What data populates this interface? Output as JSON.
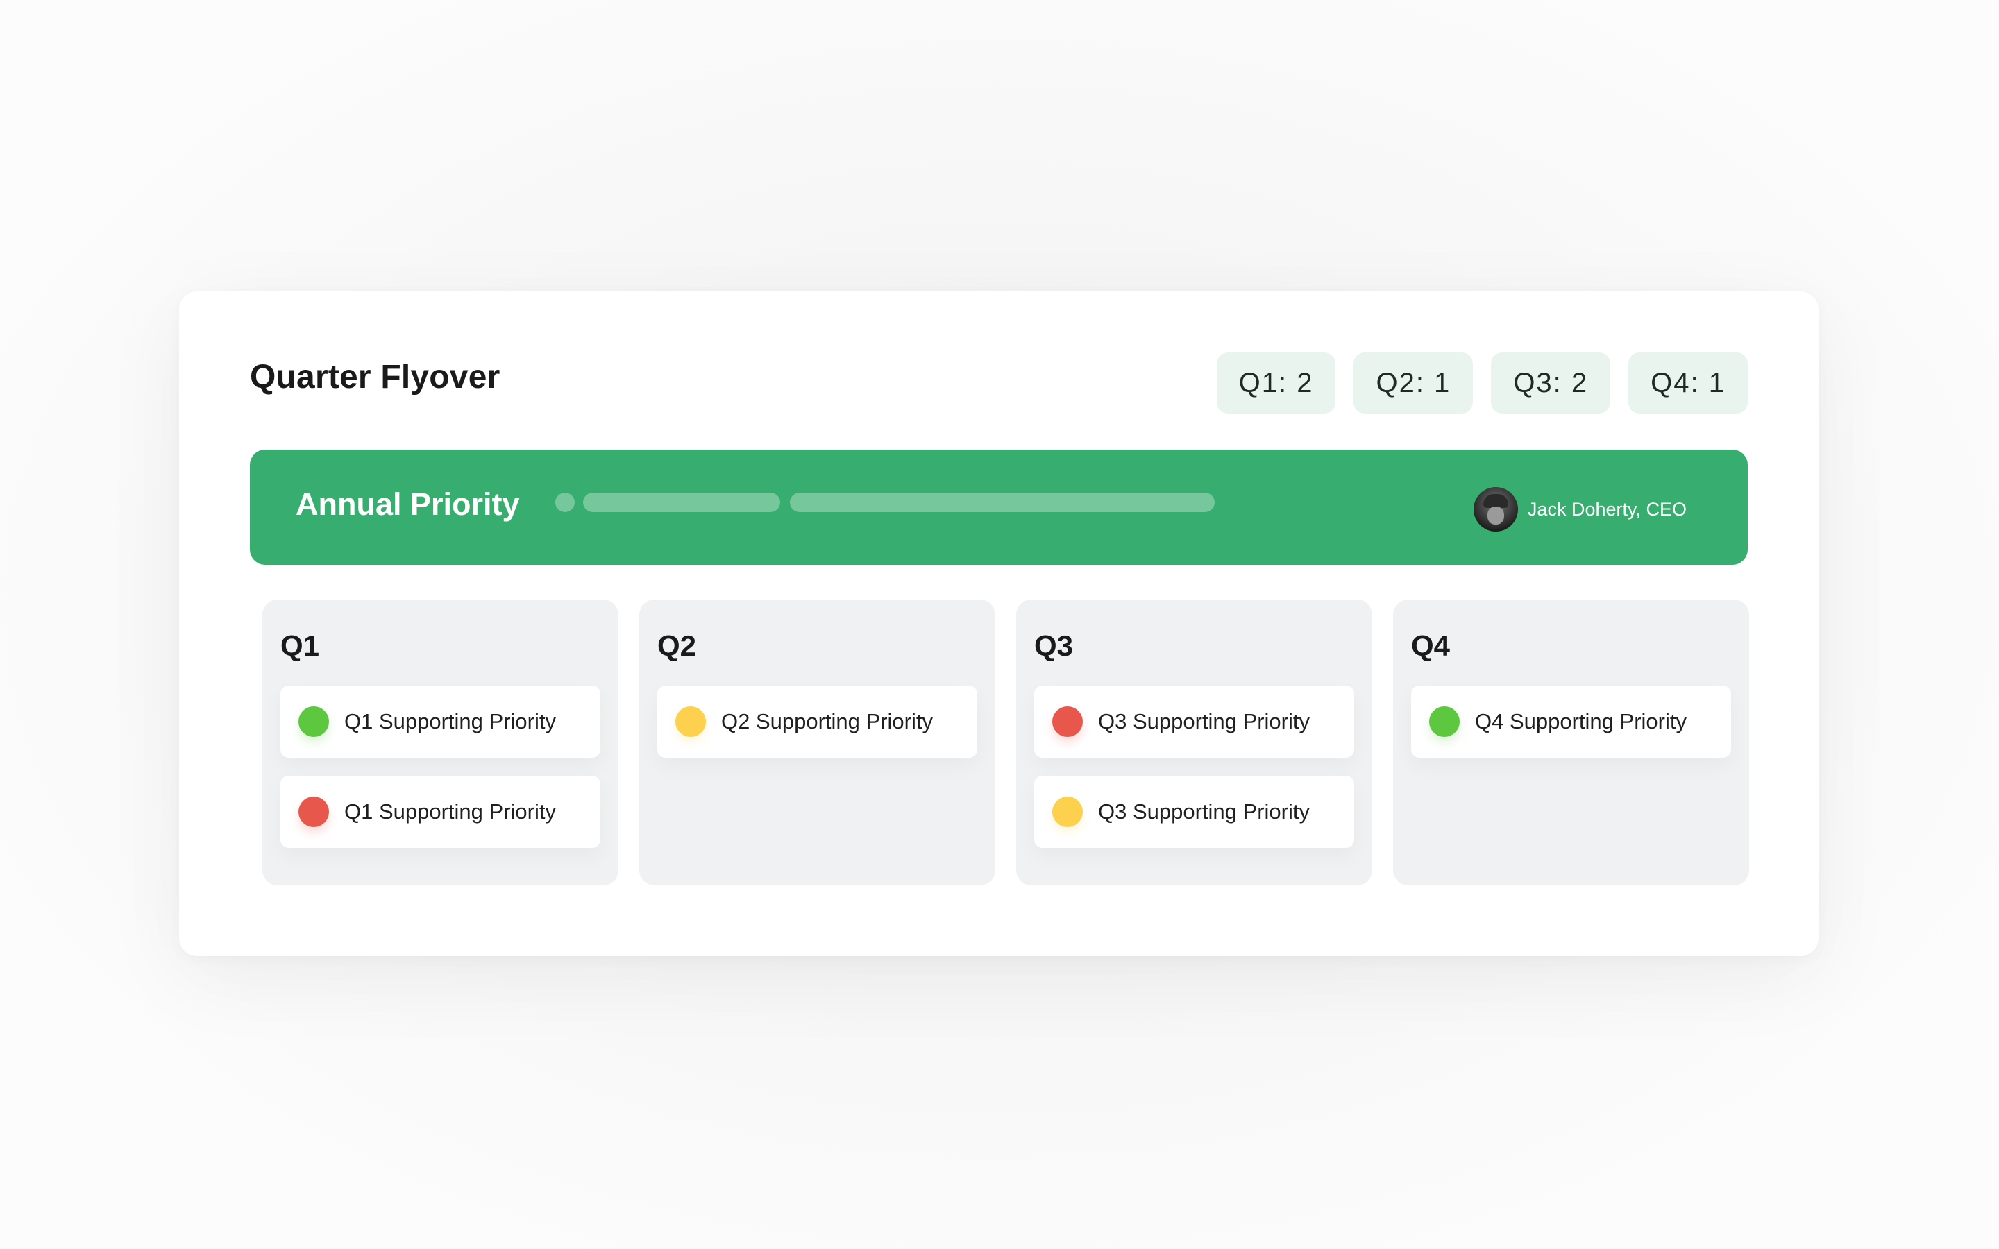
{
  "page": {
    "title": "Quarter Flyover"
  },
  "counts": [
    {
      "label": "Q1: 2"
    },
    {
      "label": "Q2: 1"
    },
    {
      "label": "Q3: 2"
    },
    {
      "label": "Q4: 1"
    }
  ],
  "banner": {
    "title": "Annual Priority",
    "owner": "Jack Doherty, CEO",
    "color": "#37ad6f"
  },
  "status_colors": {
    "green": "#5cc73f",
    "red": "#e8574c",
    "yellow": "#fdd14e"
  },
  "quarters": [
    {
      "title": "Q1",
      "items": [
        {
          "label": "Q1 Supporting Priority",
          "status": "green"
        },
        {
          "label": "Q1 Supporting Priority",
          "status": "red"
        }
      ]
    },
    {
      "title": "Q2",
      "items": [
        {
          "label": "Q2 Supporting Priority",
          "status": "yellow"
        }
      ]
    },
    {
      "title": "Q3",
      "items": [
        {
          "label": "Q3 Supporting Priority",
          "status": "red"
        },
        {
          "label": "Q3 Supporting Priority",
          "status": "yellow"
        }
      ]
    },
    {
      "title": "Q4",
      "items": [
        {
          "label": "Q4 Supporting Priority",
          "status": "green"
        }
      ]
    }
  ]
}
